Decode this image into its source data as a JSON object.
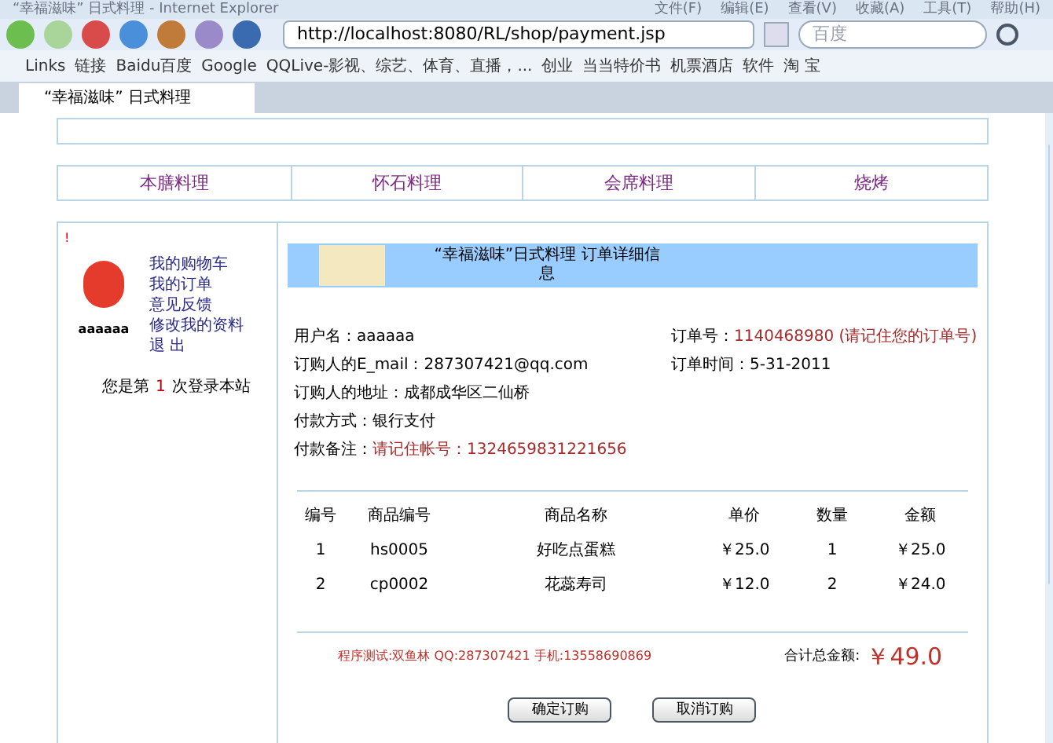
{
  "window": {
    "title": "“幸福滋味” 日式料理 - Internet Explorer",
    "menu": [
      "文件(F)",
      "编辑(E)",
      "查看(V)",
      "收藏(A)",
      "工具(T)",
      "帮助(H)"
    ]
  },
  "address_bar": {
    "url": "http://localhost:8080/RL/shop/payment.jsp",
    "search_placeholder": "百度"
  },
  "bookmarks": [
    "Links",
    "链接",
    "Baidu百度",
    "Google",
    "QQLive-影视、综艺、体育、直播，...",
    "创业",
    "当当特价书",
    "机票酒店",
    "软件",
    "淘 宝"
  ],
  "tabs": [
    {
      "label": "“幸福滋味” 日式料理",
      "selected": true
    }
  ],
  "nav": [
    "本膳料理",
    "怀石料理",
    "会席料理",
    "烧烤"
  ],
  "sidebar": {
    "mark": "!",
    "username": "aaaaaa",
    "links": [
      "我的购物车",
      "我的订单",
      "意见反馈",
      "修改我的资料",
      "退 出"
    ],
    "login_prefix": "您是第",
    "login_count": "1",
    "login_suffix": "次登录本站"
  },
  "order": {
    "title": "“幸福滋味”日式料理 订单详细信息",
    "fields": [
      {
        "label": "用户名：",
        "value": "aaaaaa",
        "highlight": false
      },
      {
        "label": "订单号：",
        "value": "1140468980 (请记住您的订单号)",
        "highlight": true
      },
      {
        "label": "订购人的E_mail：",
        "value": "287307421@qq.com",
        "highlight": false
      },
      {
        "label": "订单时间：",
        "value": "5-31-2011",
        "highlight": false
      },
      {
        "label": "订购人的地址：",
        "value": "成都成华区二仙桥",
        "highlight": false
      },
      {
        "label": "付款方式：",
        "value": "银行支付",
        "highlight": false
      },
      {
        "label": "付款备注：",
        "value": "请记住帐号：1324659831221656",
        "highlight": true
      }
    ],
    "table": {
      "columns": [
        "编号",
        "商品编号",
        "商品名称",
        "单价",
        "数量",
        "金额"
      ],
      "rows": [
        [
          "1",
          "hs0005",
          "好吃点蛋糕",
          "￥25.0",
          "1",
          "￥25.0"
        ],
        [
          "2",
          "cp0002",
          "花蕊寿司",
          "￥12.0",
          "2",
          "￥24.0"
        ]
      ]
    },
    "credit": "程序测试:双鱼林 QQ:287307421 手机:13558690869",
    "total_label": "合计总金额:",
    "total": "￥49.0",
    "buttons": [
      "确定订购",
      "取消订购"
    ]
  }
}
